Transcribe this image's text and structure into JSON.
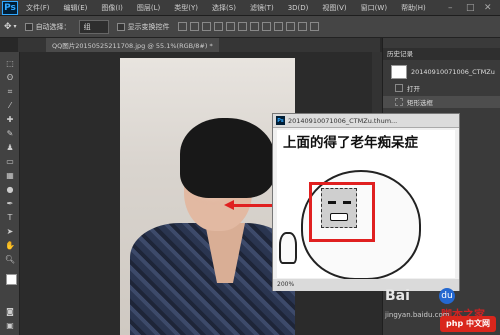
{
  "app": {
    "logo": "Ps",
    "menu": [
      "文件(F)",
      "编辑(E)",
      "图像(I)",
      "图层(L)",
      "类型(Y)",
      "选择(S)",
      "滤镜(T)",
      "3D(D)",
      "视图(V)",
      "窗口(W)",
      "帮助(H)"
    ],
    "window_controls": [
      "–",
      "□",
      "✕"
    ]
  },
  "options_bar": {
    "auto_select_label": "自动选择：",
    "auto_select_value": "组",
    "show_transform_label": "显示变换控件"
  },
  "document_tab": {
    "title": "QQ图片20150525211708.jpg @ 55.1%(RGB/8#) *"
  },
  "history_panel": {
    "title": "历史记录",
    "snapshot_label": "20140910071006_CTMZu",
    "items": [
      "打开",
      "矩形选框"
    ]
  },
  "popup": {
    "title": "20140910071006_CTMZu.thum...",
    "caption": "上面的得了老年痴呆症",
    "zoom": "200%"
  },
  "watermark": {
    "brand": "Bai",
    "brand_paw": "du",
    "site_cn": "脚本之家",
    "site_en": "jingyan.baidu.com",
    "badge": "php 中文网"
  },
  "colors": {
    "highlight_red": "#e02020",
    "ps_blue": "#31a8ff"
  }
}
